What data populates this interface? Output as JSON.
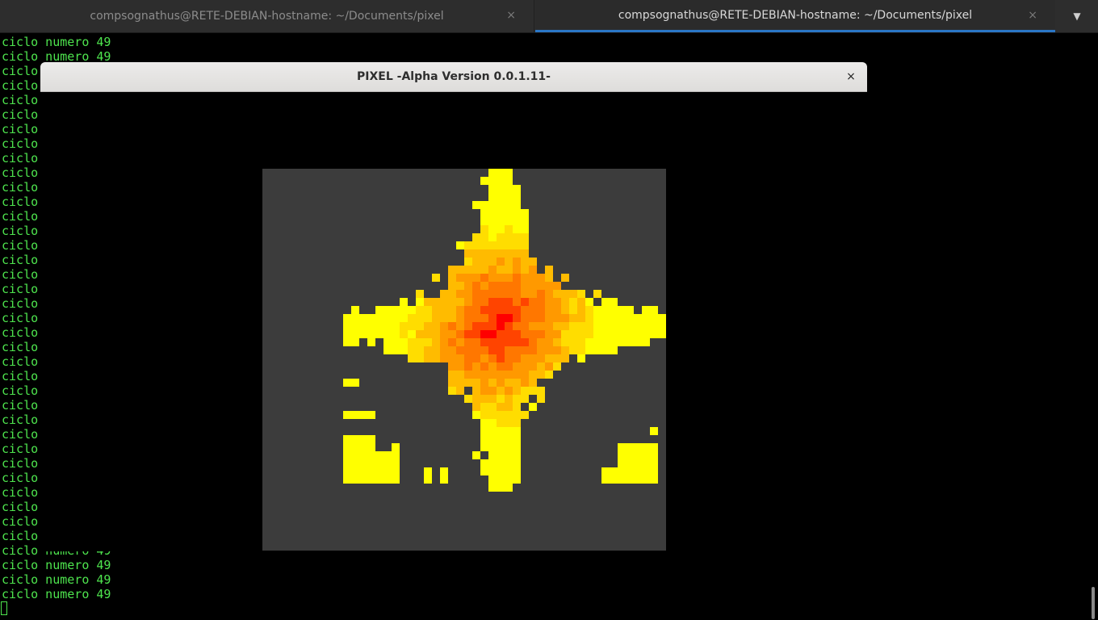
{
  "tabs": [
    {
      "title": "compsognathus@RETE-DEBIAN-hostname: ~/Documents/pixel",
      "close": "×",
      "active": false
    },
    {
      "title": "compsognathus@RETE-DEBIAN-hostname: ~/Documents/pixel",
      "close": "×",
      "active": true
    }
  ],
  "tab_menu_icon": "chevron-down-icon",
  "terminal": {
    "visible_lines": [
      "ciclo numero 49",
      "ciclo numero 49",
      "ciclo",
      "ciclo",
      "ciclo",
      "ciclo",
      "ciclo",
      "ciclo",
      "ciclo",
      "ciclo",
      "ciclo",
      "ciclo",
      "ciclo",
      "ciclo",
      "ciclo",
      "ciclo",
      "ciclo",
      "ciclo",
      "ciclo",
      "ciclo",
      "ciclo",
      "ciclo",
      "ciclo",
      "ciclo",
      "ciclo",
      "ciclo",
      "ciclo",
      "ciclo",
      "ciclo",
      "ciclo",
      "ciclo",
      "ciclo",
      "ciclo",
      "ciclo",
      "ciclo",
      "ciclo numero 49",
      "ciclo numero 49",
      "ciclo numero 49",
      "ciclo numero 49"
    ],
    "text_color": "#4ee44e"
  },
  "pixel_window": {
    "title": "PIXEL -Alpha Version 0.0.1.11-",
    "close": "×",
    "canvas_bg": "#3c3c3c"
  },
  "colors": {
    "level_1": "#ffff00",
    "level_2": "#ffdd00",
    "level_3": "#ffbb00",
    "level_4": "#ff9900",
    "level_5": "#ff7700",
    "level_6": "#ff4400",
    "level_7": "#ff0000"
  }
}
